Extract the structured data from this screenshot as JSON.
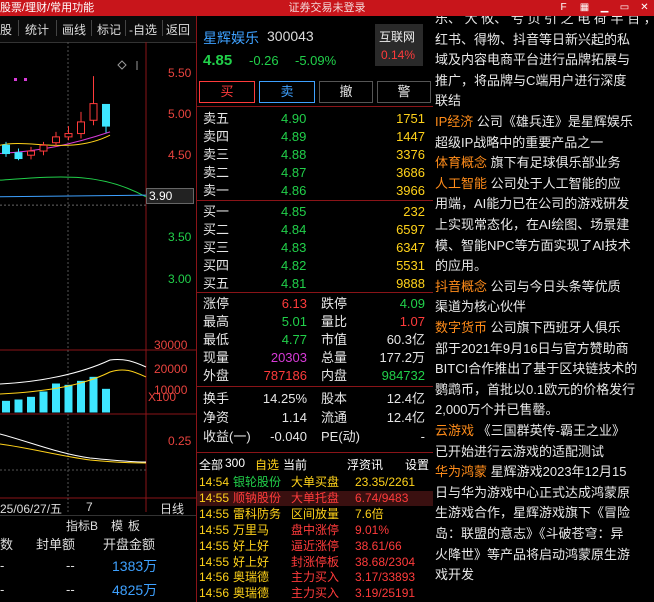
{
  "topbar": {
    "left_fragment": "股票/理财/常用功能",
    "title": "证券交易未登录"
  },
  "left_menu": {
    "items": [
      "股",
      "统计",
      "画线",
      "标记",
      "-自选",
      "返回"
    ]
  },
  "left_price_axis": [
    "5.50",
    "5.00",
    "4.50",
    "3.90",
    "3.50",
    "3.00"
  ],
  "left_volume_axis": [
    "30000",
    "20000",
    "10000",
    "X100"
  ],
  "left_indicator_axis": [
    "0.25"
  ],
  "left_date": "25/06/27/五",
  "left_date_tail": "7",
  "left_daily": "日线",
  "left_bottom_tabs": [
    "指标B",
    "模",
    "板"
  ],
  "left_table": {
    "headers": [
      "数",
      "封单额",
      "开盘金额"
    ],
    "rows": [
      [
        "-",
        "--",
        "1383万"
      ],
      [
        "-",
        "--",
        "4825万"
      ]
    ]
  },
  "quote": {
    "name": "星辉娱乐",
    "code": "300043",
    "sector": "互联网",
    "sector_pct": "0.14%",
    "price": "4.85",
    "change": "-0.26",
    "change_pct": "-5.09%",
    "buttons": [
      "买",
      "卖",
      "撤",
      "警"
    ],
    "sells": [
      {
        "label": "卖五",
        "price": "4.90",
        "vol": "1751"
      },
      {
        "label": "卖四",
        "price": "4.89",
        "vol": "1447"
      },
      {
        "label": "卖三",
        "price": "4.88",
        "vol": "3376"
      },
      {
        "label": "卖二",
        "price": "4.87",
        "vol": "3686"
      },
      {
        "label": "卖一",
        "price": "4.86",
        "vol": "3966"
      }
    ],
    "buys": [
      {
        "label": "买一",
        "price": "4.85",
        "vol": "232"
      },
      {
        "label": "买二",
        "price": "4.84",
        "vol": "6597"
      },
      {
        "label": "买三",
        "price": "4.83",
        "vol": "6347"
      },
      {
        "label": "买四",
        "price": "4.82",
        "vol": "5531"
      },
      {
        "label": "买五",
        "price": "4.81",
        "vol": "9888"
      }
    ],
    "stats": [
      {
        "l1": "涨停",
        "v1": "6.13",
        "c1": "red",
        "l2": "跌停",
        "v2": "4.09",
        "c2": "green"
      },
      {
        "l1": "最高",
        "v1": "5.01",
        "c1": "green",
        "l2": "量比",
        "v2": "1.07",
        "c2": "red"
      },
      {
        "l1": "最低",
        "v1": "4.77",
        "c1": "green",
        "l2": "市值",
        "v2": "60.3亿",
        "c2": "white"
      },
      {
        "l1": "现量",
        "v1": "20303",
        "c1": "mag",
        "l2": "总量",
        "v2": "177.2万",
        "c2": "white"
      },
      {
        "l1": "外盘",
        "v1": "787186",
        "c1": "red",
        "l2": "内盘",
        "v2": "984732",
        "c2": "green"
      }
    ],
    "stats2": [
      {
        "l1": "换手",
        "v1": "14.25%",
        "l2": "股本",
        "v2": "12.4亿"
      },
      {
        "l1": "净资",
        "v1": "1.14",
        "l2": "流通",
        "v2": "12.4亿"
      },
      {
        "l1": "收益(一)",
        "v1": "-0.040",
        "l2": "PE(动)",
        "v2": "-"
      }
    ],
    "filter": {
      "all": "全部",
      "num": "300",
      "self": "自选",
      "current": "当前",
      "float": "浮",
      "news": "资讯",
      "set": "设置"
    },
    "feed": [
      {
        "time": "14:54",
        "name": "银轮股份",
        "event": "大单买盘",
        "val": "23.35/2261",
        "nc": "green",
        "ec": "yel",
        "vc": "yel"
      },
      {
        "time": "14:55",
        "name": "顺钠股份",
        "event": "大单托盘",
        "val": "6.74/9483",
        "nc": "red",
        "ec": "red",
        "vc": "red",
        "hl": true
      },
      {
        "time": "14:55",
        "name": "雷科防务",
        "event": "区间放量",
        "val": "7.6倍",
        "nc": "yel",
        "ec": "yel",
        "vc": "yel"
      },
      {
        "time": "14:55",
        "name": "万里马",
        "event": "盘中涨停",
        "val": "9.01%",
        "nc": "yel",
        "ec": "red",
        "vc": "red"
      },
      {
        "time": "14:55",
        "name": "好上好",
        "event": "逼近涨停",
        "val": "38.61/66",
        "nc": "yel",
        "ec": "red",
        "vc": "red"
      },
      {
        "time": "14:55",
        "name": "好上好",
        "event": "封涨停板",
        "val": "38.68/2304",
        "nc": "yel",
        "ec": "red",
        "vc": "red"
      },
      {
        "time": "14:56",
        "name": "奥瑞德",
        "event": "主力买入",
        "val": "3.17/33893",
        "nc": "yel",
        "ec": "red",
        "vc": "red"
      },
      {
        "time": "14:56",
        "name": "奥瑞德",
        "event": "主力买入",
        "val": "3.19/25191",
        "nc": "yel",
        "ec": "red",
        "vc": "red"
      }
    ]
  },
  "right_text": [
    [
      {
        "t": "乐、 大 攸、 亏 页 引 之 电 荷 半 百 ，",
        "c": "w"
      }
    ],
    [
      {
        "t": "红书、得物、抖音等日新兴起的私",
        "c": "w"
      }
    ],
    [
      {
        "t": "域及内容电商平台进行品牌拓展与",
        "c": "w"
      }
    ],
    [
      {
        "t": "推广，将品牌与C端用户进行深度",
        "c": "w"
      }
    ],
    [
      {
        "t": "联结",
        "c": "w"
      }
    ],
    [
      {
        "t": "IP经济",
        "c": "o"
      },
      {
        "t": "  公司《雄兵连》是星辉娱乐",
        "c": "w"
      }
    ],
    [
      {
        "t": "超级IP战略中的重要产品之一",
        "c": "w"
      }
    ],
    [
      {
        "t": "体育概念",
        "c": "o"
      },
      {
        "t": "  旗下有足球俱乐部业务",
        "c": "w"
      }
    ],
    [
      {
        "t": "人工智能",
        "c": "o"
      },
      {
        "t": "  公司处于人工智能的应",
        "c": "w"
      }
    ],
    [
      {
        "t": "用端，AI能力已在公司的游戏研发",
        "c": "w"
      }
    ],
    [
      {
        "t": "上实现常态化，在AI绘图、场景建",
        "c": "w"
      }
    ],
    [
      {
        "t": "模、智能NPC等方面实现了AI技术",
        "c": "w"
      }
    ],
    [
      {
        "t": "的应用。",
        "c": "w"
      }
    ],
    [
      {
        "t": "抖音概念",
        "c": "o"
      },
      {
        "t": "  公司与今日头条等优质",
        "c": "w"
      }
    ],
    [
      {
        "t": "渠道为核心伙伴",
        "c": "w"
      }
    ],
    [
      {
        "t": "数字货币",
        "c": "o"
      },
      {
        "t": "  公司旗下西班牙人俱乐",
        "c": "w"
      }
    ],
    [
      {
        "t": "部于2021年9月16日与官方赞助商",
        "c": "w"
      }
    ],
    [
      {
        "t": "BITCI合作推出了基于区块链技术的",
        "c": "w"
      }
    ],
    [
      {
        "t": "鹦鹉币，首批以0.1欧元的价格发行",
        "c": "w"
      }
    ],
    [
      {
        "t": "2,000万个并已售罄。",
        "c": "w"
      }
    ],
    [
      {
        "t": "云游戏",
        "c": "o"
      },
      {
        "t": "  《三国群英传-霸王之业》",
        "c": "w"
      }
    ],
    [
      {
        "t": "已开始进行云游戏的适配测试",
        "c": "w"
      }
    ],
    [
      {
        "t": "华为鸿蒙",
        "c": "o"
      },
      {
        "t": "  星辉游戏2023年12月15",
        "c": "w"
      }
    ],
    [
      {
        "t": "日与华为游戏中心正式达成鸿蒙原",
        "c": "w"
      }
    ],
    [
      {
        "t": "生游戏合作，星辉游戏旗下《冒险",
        "c": "w"
      }
    ],
    [
      {
        "t": "岛：联盟的意志》《斗破苍穹：异",
        "c": "w"
      }
    ],
    [
      {
        "t": "火降世》等产品将启动鸿蒙原生游",
        "c": "w"
      }
    ],
    [
      {
        "t": "戏开发",
        "c": "w"
      }
    ]
  ],
  "chart_data": {
    "type": "candlestick",
    "title": "",
    "price_axis": [
      5.5,
      5.0,
      4.5,
      3.9,
      3.5,
      3.0
    ],
    "volume_axis": [
      30000,
      20000,
      10000
    ],
    "volume_unit": "X100",
    "indicator_axis": [
      0.25
    ],
    "candles": [
      {
        "o": 4.62,
        "c": 4.52,
        "h": 4.66,
        "l": 4.48
      },
      {
        "o": 4.53,
        "c": 4.46,
        "h": 4.58,
        "l": 4.44
      },
      {
        "o": 4.5,
        "c": 4.55,
        "h": 4.6,
        "l": 4.45
      },
      {
        "o": 4.55,
        "c": 4.62,
        "h": 4.66,
        "l": 4.5
      },
      {
        "o": 4.65,
        "c": 4.72,
        "h": 4.78,
        "l": 4.6
      },
      {
        "o": 4.72,
        "c": 4.76,
        "h": 4.85,
        "l": 4.68
      },
      {
        "o": 4.76,
        "c": 4.9,
        "h": 5.02,
        "l": 4.7
      },
      {
        "o": 4.92,
        "c": 5.12,
        "h": 5.45,
        "l": 4.86
      },
      {
        "o": 5.11,
        "c": 4.85,
        "h": 5.01,
        "l": 4.77
      }
    ],
    "volumes": [
      8000,
      9000,
      11000,
      15000,
      21000,
      20000,
      23000,
      26000,
      17000
    ]
  }
}
